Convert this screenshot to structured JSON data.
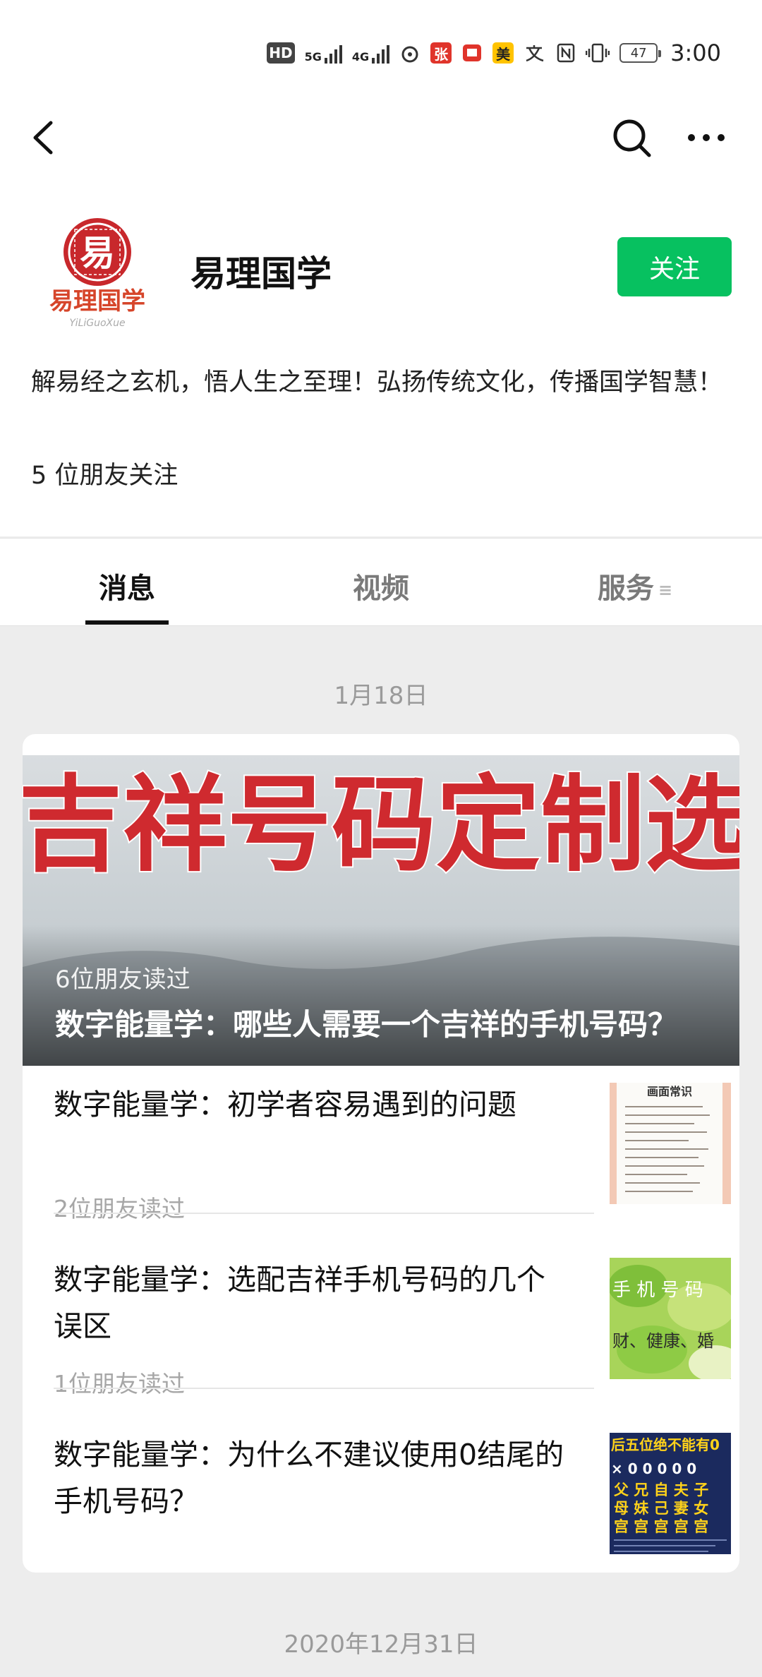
{
  "status_bar": {
    "hd_label": "HD",
    "net1": "5G",
    "net2": "4G",
    "app_badge_zhang": "张",
    "app_badge_mei": "美",
    "battery": "47",
    "time": "3:00"
  },
  "header": {
    "back_icon": "chevron-left-icon",
    "search_icon": "search-icon",
    "more_icon": "more-horizontal-icon"
  },
  "profile": {
    "logo_glyph": "易",
    "logo_text": "易理国学",
    "logo_pinyin": "YiLiGuoXue",
    "name": "易理国学",
    "follow_label": "关注",
    "bio": "解易经之玄机，悟人生之至理！弘扬传统文化，传播国学智慧！",
    "friends_following": "5 位朋友关注"
  },
  "tabs": [
    {
      "label": "消息",
      "active": true
    },
    {
      "label": "视频",
      "active": false
    },
    {
      "label": "服务",
      "active": false,
      "icon": "menu-lines-icon"
    }
  ],
  "feed": [
    {
      "date": "1月18日",
      "cover": {
        "image_text": "吉祥号码定制选",
        "readers": "6位朋友读过",
        "title": "数字能量学：哪些人需要一个吉祥的手机号码？"
      },
      "items": [
        {
          "title": "数字能量学：初学者容易遇到的问题",
          "readers": "2位朋友读过",
          "thumb_heading": "画面常识"
        },
        {
          "title": "数字能量学：选配吉祥手机号码的几个误区",
          "readers": "1位朋友读过",
          "thumb_line1": "手 机 号 码",
          "thumb_line2": "财、健康、婚"
        },
        {
          "title": "数字能量学：为什么不建议使用0结尾的手机号码？",
          "readers": "",
          "thumb_banner": "后五位绝不能有0",
          "thumb_row1": "× 0 0 0 0 0",
          "thumb_row2": "父 兄 自 夫 子",
          "thumb_row3": "母 妹 己 妻 女",
          "thumb_row4": "宫 宫 宫 宫 宫"
        }
      ]
    },
    {
      "date": "2020年12月31日"
    }
  ],
  "colors": {
    "accent_green": "#07c160",
    "background": "#ededed",
    "logo_red": "#c8282c"
  }
}
